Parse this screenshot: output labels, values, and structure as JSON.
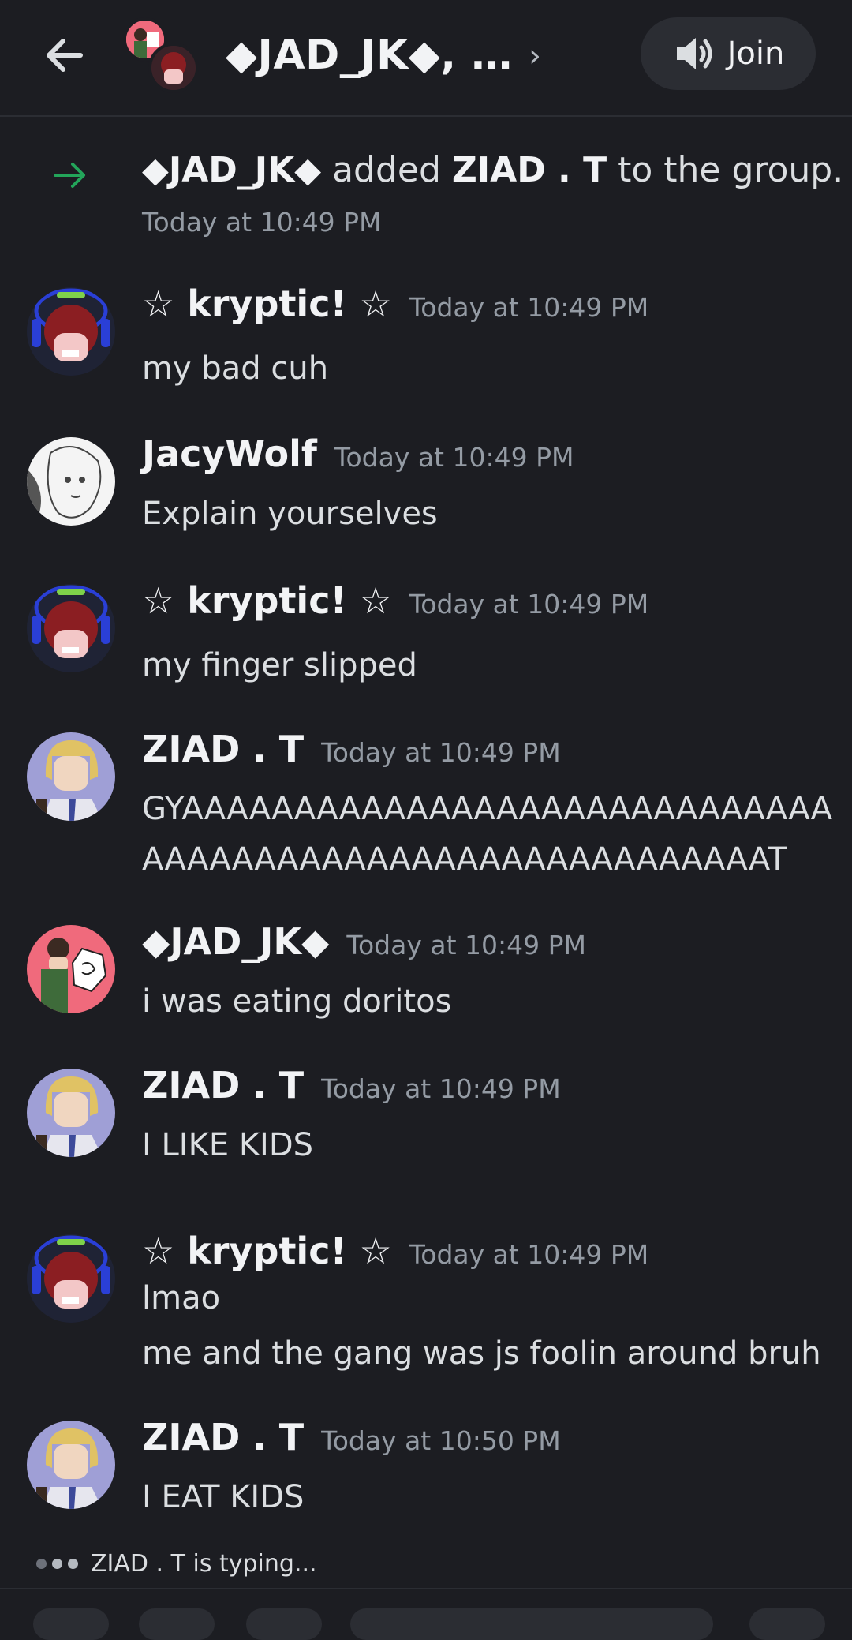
{
  "header": {
    "title": "◆JAD_JK◆, …",
    "join_label": "Join"
  },
  "system_message": {
    "actor": "◆JAD_JK◆",
    "verb": " added ",
    "target": "ZIAD . T",
    "suffix": " to the group.",
    "time": "Today at 10:49 PM"
  },
  "messages": [
    {
      "author": "☆ kryptic! ☆",
      "time": "Today at 10:49 PM",
      "lines": [
        "my bad cuh"
      ]
    },
    {
      "author": "JacyWolf",
      "time": "Today at 10:49 PM",
      "lines": [
        "Explain yourselves"
      ]
    },
    {
      "author": "☆ kryptic! ☆",
      "time": "Today at 10:49 PM",
      "lines": [
        "my finger slipped"
      ]
    },
    {
      "author": "ZIAD . T",
      "time": "Today at 10:49 PM",
      "lines": [
        "GYAAAAAAAAAAAAAAAAAAAAAAAAAAAAA",
        "AAAAAAAAAAAAAAAAAAAAAAAAAAAAT"
      ]
    },
    {
      "author": "◆JAD_JK◆",
      "time": "Today at 10:49 PM",
      "lines": [
        "i was eating doritos"
      ]
    },
    {
      "author": "ZIAD . T",
      "time": "Today at 10:49 PM",
      "lines": [
        "I LIKE KIDS"
      ]
    },
    {
      "author": "☆ kryptic! ☆",
      "time": "Today at 10:49 PM",
      "lines": [
        "lmao",
        "me and the gang was js foolin around bruh"
      ]
    },
    {
      "author": "ZIAD . T",
      "time": "Today at 10:50 PM",
      "lines": [
        "I EAT KIDS"
      ]
    }
  ],
  "typing": {
    "text": "ZIAD . T is typing..."
  },
  "colors": {
    "background": "#1c1d22",
    "join_button": "#2b2d33",
    "system_arrow": "#23a55a",
    "timestamp": "#949ba4"
  }
}
